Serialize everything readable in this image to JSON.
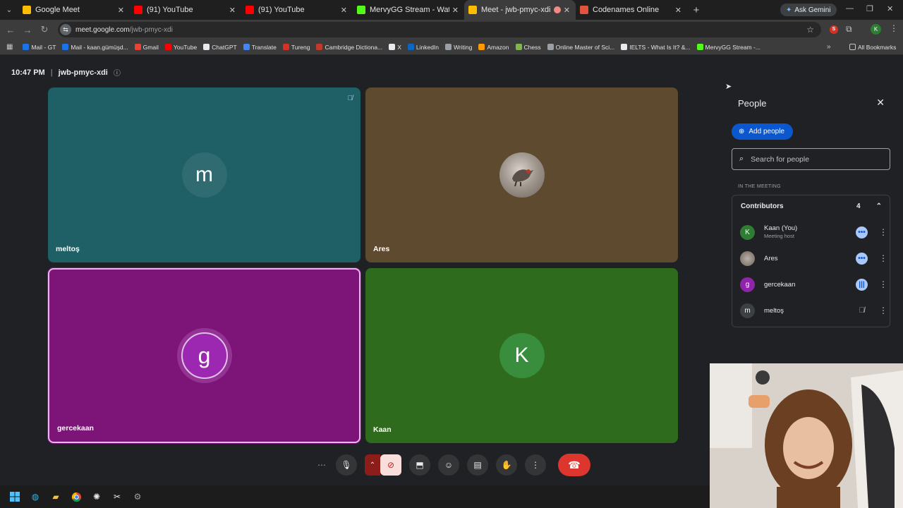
{
  "browser": {
    "tabs": [
      {
        "title": "Google Meet",
        "color": "#fbbc04",
        "active": false
      },
      {
        "title": "(91) YouTube",
        "color": "#ff0000",
        "active": false
      },
      {
        "title": "(91) YouTube",
        "color": "#ff0000",
        "active": false
      },
      {
        "title": "MervyGG Stream - Watch Live o",
        "color": "#53fc18",
        "active": false
      },
      {
        "title": "Meet - jwb-pmyc-xdi",
        "color": "#fbbc04",
        "active": true
      },
      {
        "title": "Codenames Online",
        "color": "#e0533c",
        "active": false
      }
    ],
    "ask_gemini": "Ask Gemini",
    "url_host": "meet.google.com",
    "url_path": "/jwb-pmyc-xdi",
    "bookmarks": [
      {
        "label": "Mail - GT",
        "color": "#1a73e8"
      },
      {
        "label": "Mail - kaan.gümüşd...",
        "color": "#1a73e8"
      },
      {
        "label": "Gmail",
        "color": "#ea4335"
      },
      {
        "label": "YouTube",
        "color": "#ff0000"
      },
      {
        "label": "ChatGPT",
        "color": "#e8eaed"
      },
      {
        "label": "Translate",
        "color": "#4285f4"
      },
      {
        "label": "Tureng",
        "color": "#d93025"
      },
      {
        "label": "Cambridge Dictiona...",
        "color": "#c0392b"
      },
      {
        "label": "X",
        "color": "#e8eaed"
      },
      {
        "label": "LinkedIn",
        "color": "#0a66c2"
      },
      {
        "label": "Writing",
        "color": "#9aa0a6"
      },
      {
        "label": "Amazon",
        "color": "#ff9900"
      },
      {
        "label": "Chess",
        "color": "#81b64c"
      },
      {
        "label": "Online Master of Sci...",
        "color": "#9aa0a6"
      },
      {
        "label": "IELTS - What Is It? &...",
        "color": "#e8eaed"
      },
      {
        "label": "MervyGG Stream -...",
        "color": "#53fc18"
      }
    ],
    "all_bookmarks": "All Bookmarks"
  },
  "meeting": {
    "time": "10:47 PM",
    "separator": "|",
    "code": "jwb-pmyc-xdi",
    "participant_count": "4",
    "tiles": [
      {
        "name": "meltoş",
        "initial": "m",
        "bg": "#1f5f66",
        "avatar_bg": "#2f6b70",
        "muted": true
      },
      {
        "name": "Ares",
        "initial": "",
        "bg": "#5e4a2f",
        "avatar_bg": "#8a8078",
        "muted": false
      },
      {
        "name": "gercekaan",
        "initial": "g",
        "bg": "#7d1478",
        "avatar_bg": "#9c27b0",
        "muted": false
      },
      {
        "name": "Kaan",
        "initial": "K",
        "bg": "#2f6b1d",
        "avatar_bg": "#388e3c",
        "muted": false
      }
    ]
  },
  "people_panel": {
    "title": "People",
    "add_people": "Add people",
    "search_placeholder": "Search for people",
    "section_label": "IN THE MEETING",
    "group_label": "Contributors",
    "group_count": "4",
    "participants": [
      {
        "name": "Kaan (You)",
        "subtitle": "Meeting host",
        "initial": "K",
        "color": "#2e7d32",
        "status": "speaking-dots"
      },
      {
        "name": "Ares",
        "subtitle": "",
        "initial": "",
        "color": "#6d6258",
        "status": "speaking-dots"
      },
      {
        "name": "gercekaan",
        "subtitle": "",
        "initial": "g",
        "color": "#8e24aa",
        "status": "speaking-bars"
      },
      {
        "name": "meltoş",
        "subtitle": "",
        "initial": "m",
        "color": "#3c4043",
        "status": "muted"
      }
    ]
  }
}
